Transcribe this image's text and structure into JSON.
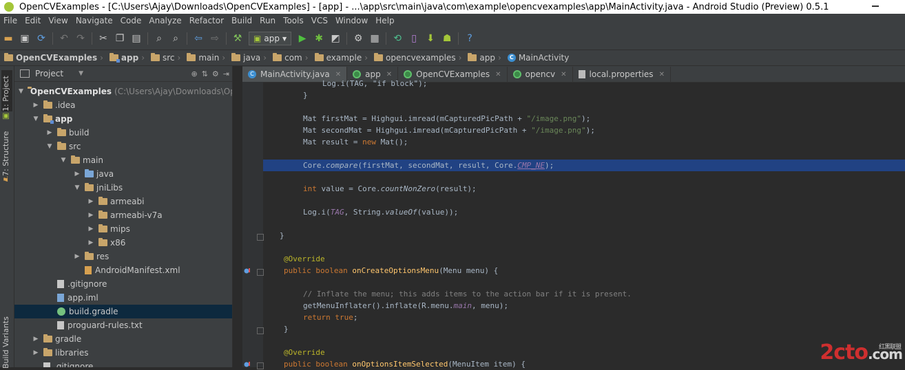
{
  "window": {
    "title": "OpenCVExamples - [C:\\Users\\Ajay\\Downloads\\OpenCVExamples] - [app] - ...\\app\\src\\main\\java\\com\\example\\opencvexamples\\app\\MainActivity.java - Android Studio (Preview) 0.5.1"
  },
  "menu": [
    "File",
    "Edit",
    "View",
    "Navigate",
    "Code",
    "Analyze",
    "Refactor",
    "Build",
    "Run",
    "Tools",
    "VCS",
    "Window",
    "Help"
  ],
  "toolbar": {
    "run_config": "app"
  },
  "breadcrumbs": [
    "OpenCVExamples",
    "app",
    "src",
    "main",
    "java",
    "com",
    "example",
    "opencvexamples",
    "app",
    "MainActivity"
  ],
  "side_tabs": {
    "project": "1: Project",
    "structure": "7: Structure",
    "variants": "Build Variants"
  },
  "project_panel": {
    "title": "Project"
  },
  "tree": [
    {
      "label": "OpenCVExamples",
      "path": "(C:\\Users\\Ajay\\Downloads\\Open",
      "level": 0,
      "arrow": "down",
      "icon": "folder",
      "bold": true
    },
    {
      "label": ".idea",
      "level": 1,
      "arrow": "right",
      "icon": "folder"
    },
    {
      "label": "app",
      "level": 1,
      "arrow": "down",
      "icon": "folder-mod",
      "bold": true
    },
    {
      "label": "build",
      "level": 2,
      "arrow": "right",
      "icon": "folder"
    },
    {
      "label": "src",
      "level": 2,
      "arrow": "down",
      "icon": "folder"
    },
    {
      "label": "main",
      "level": 3,
      "arrow": "down",
      "icon": "folder"
    },
    {
      "label": "java",
      "level": 4,
      "arrow": "right",
      "icon": "folder-blue"
    },
    {
      "label": "jniLibs",
      "level": 4,
      "arrow": "down",
      "icon": "folder"
    },
    {
      "label": "armeabi",
      "level": 5,
      "arrow": "right",
      "icon": "folder"
    },
    {
      "label": "armeabi-v7a",
      "level": 5,
      "arrow": "right",
      "icon": "folder"
    },
    {
      "label": "mips",
      "level": 5,
      "arrow": "right",
      "icon": "folder"
    },
    {
      "label": "x86",
      "level": 5,
      "arrow": "right",
      "icon": "folder"
    },
    {
      "label": "res",
      "level": 4,
      "arrow": "right",
      "icon": "folder"
    },
    {
      "label": "AndroidManifest.xml",
      "level": 4,
      "arrow": "",
      "icon": "xml"
    },
    {
      "label": ".gitignore",
      "level": 2,
      "arrow": "",
      "icon": "file"
    },
    {
      "label": "app.iml",
      "level": 2,
      "arrow": "",
      "icon": "iml"
    },
    {
      "label": "build.gradle",
      "level": 2,
      "arrow": "",
      "icon": "gradle",
      "selected": true
    },
    {
      "label": "proguard-rules.txt",
      "level": 2,
      "arrow": "",
      "icon": "file"
    },
    {
      "label": "gradle",
      "level": 1,
      "arrow": "right",
      "icon": "folder"
    },
    {
      "label": "libraries",
      "level": 1,
      "arrow": "right",
      "icon": "folder"
    },
    {
      "label": ".gitignore",
      "level": 1,
      "arrow": "",
      "icon": "file"
    }
  ],
  "tabs": [
    {
      "label": "MainActivity.java",
      "icon": "c",
      "active": true
    },
    {
      "label": "app",
      "icon": "g"
    },
    {
      "label": "OpenCVExamples",
      "icon": "g"
    },
    {
      "label": "opencv",
      "icon": "g"
    },
    {
      "label": "local.properties",
      "icon": "p"
    }
  ],
  "code": {
    "l0": "Log.i(TAG, \"if block\");",
    "l1": "}",
    "l3a": "Mat firstMat = Highgui.imread(mCapturedPicPath + ",
    "l3b": "\"/image.png\"",
    "l3c": ");",
    "l4a": "Mat secondMat = Highgui.imread(mCapturedPicPath + ",
    "l4b": "\"/image.png\"",
    "l4c": ");",
    "l5a": "Mat result = ",
    "l5b": "new",
    "l5c": " Mat();",
    "l7a": "Core.",
    "l7b": "compare",
    "l7c": "(firstMat, secondMat, result, Core.",
    "l7d": "CMP_NE",
    "l7e": ");",
    "l9a": "int",
    "l9b": " value = Core.",
    "l9c": "countNonZero",
    "l9d": "(result);",
    "l11a": "Log.i(",
    "l11b": "TAG",
    "l11c": ", String.",
    "l11d": "valueOf",
    "l11e": "(value));",
    "l13": "}",
    "l15": "@Override",
    "l16a": "public boolean",
    "l16b": "onCreateOptionsMenu",
    "l16c": "(Menu menu) {",
    "l18": "// Inflate the menu; this adds items to the action bar if it is present.",
    "l19a": "getMenuInflater().inflate(R.menu.",
    "l19b": "main",
    "l19c": ", menu);",
    "l20a": "return",
    "l20b": "true",
    "l20c": ";",
    "l21": "}",
    "l23": "@Override",
    "l24a": "public boolean",
    "l24b": "onOptionsItemSelected",
    "l24c": "(MenuItem item) {"
  },
  "watermark": {
    "text1": "2",
    "text2": "cto",
    "text3": ".com",
    "small": "红黑联盟"
  }
}
